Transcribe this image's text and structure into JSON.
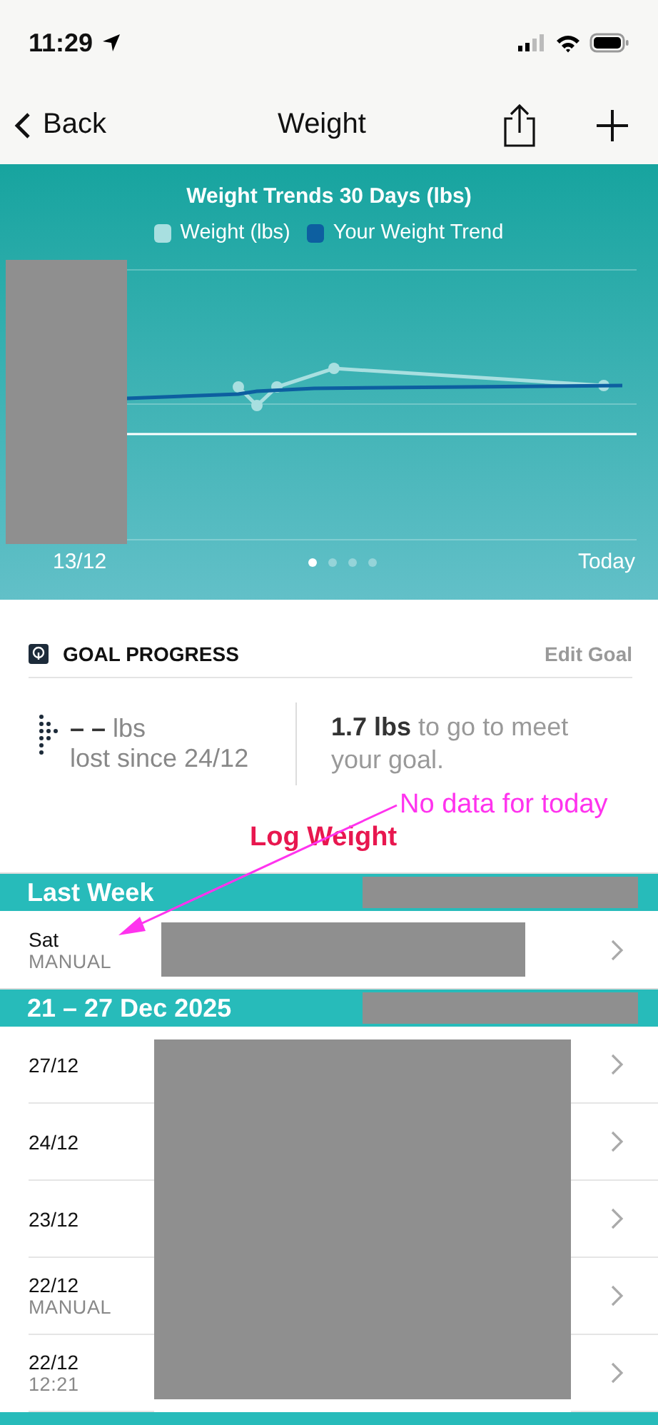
{
  "status_bar": {
    "time": "11:29"
  },
  "nav": {
    "back": "Back",
    "title": "Weight"
  },
  "chart": {
    "title": "Weight Trends 30 Days (lbs)",
    "legend": [
      {
        "label": "Weight (lbs)",
        "color": "#a8dfe0"
      },
      {
        "label": "Your Weight Trend",
        "color": "#0d5fa0"
      }
    ],
    "start_label": "13/12",
    "end_label": "Today",
    "pages": [
      {
        "selected": true
      },
      {
        "selected": false
      },
      {
        "selected": false
      },
      {
        "selected": false
      }
    ]
  },
  "goal": {
    "title": "GOAL PROGRESS",
    "edit": "Edit Goal",
    "lost_value": "– –",
    "lost_unit": "lbs",
    "lost_caption": "lost since 24/12",
    "remaining": "**1.7 lbs** to go to meet your goal."
  },
  "annotations": [
    {
      "text": "No data for today",
      "color": "#ff33ee"
    },
    {
      "text": "Log Weight",
      "color": "#e8174f"
    }
  ],
  "sections": [
    {
      "title": "Last Week",
      "rows": [
        {
          "date": "Sat",
          "sub": "MANUAL"
        }
      ]
    },
    {
      "title": "21 – 27 Dec 2025",
      "rows": [
        {
          "date": "27/12"
        },
        {
          "date": "24/12"
        },
        {
          "date": "23/12"
        },
        {
          "date": "22/12",
          "sub": "MANUAL"
        },
        {
          "date": "22/12",
          "sub": "12:21"
        }
      ]
    }
  ]
}
